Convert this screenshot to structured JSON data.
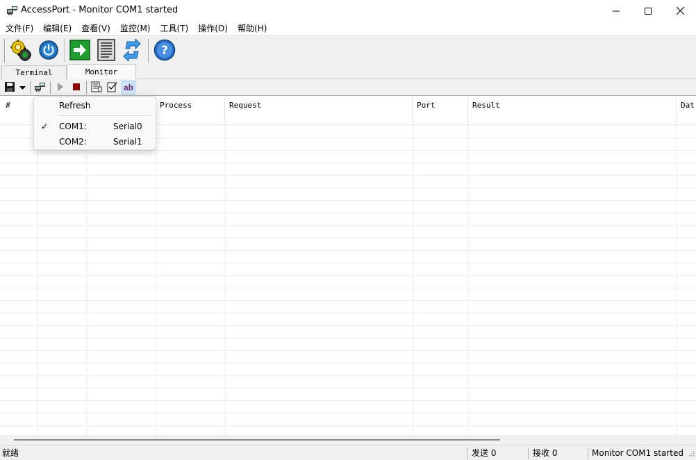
{
  "window": {
    "title": "AccessPort - Monitor COM1 started"
  },
  "menubar": {
    "items": [
      "文件(F)",
      "编辑(E)",
      "查看(V)",
      "监控(M)",
      "工具(T)",
      "操作(O)",
      "帮助(H)"
    ]
  },
  "toolbar": {
    "icons": [
      "config-gears-icon",
      "power-icon",
      "arrow-right-icon",
      "document-icon",
      "refresh-arrows-icon",
      "help-icon"
    ]
  },
  "tabs": [
    {
      "label": "Terminal",
      "active": false
    },
    {
      "label": "Monitor",
      "active": true
    }
  ],
  "toolbar2": {
    "ab_label": "ab"
  },
  "grid": {
    "columns": [
      "#",
      "",
      "Process",
      "Request",
      "Port",
      "Result",
      "Dat"
    ],
    "rows": []
  },
  "dropdown": {
    "refresh_label": "Refresh",
    "ports": [
      {
        "name": "COM1:",
        "device": "Serial0",
        "checked": true
      },
      {
        "name": "COM2:",
        "device": "Serial1",
        "checked": false
      }
    ],
    "check_glyph": "✓"
  },
  "statusbar": {
    "ready": "就绪",
    "sent": "发送 0",
    "received": "接收 0",
    "status": "Monitor COM1 started"
  },
  "colors": {
    "accent_green": "#1e9e2e",
    "help_blue": "#2a6fc9",
    "stop_red": "#8b0000"
  }
}
